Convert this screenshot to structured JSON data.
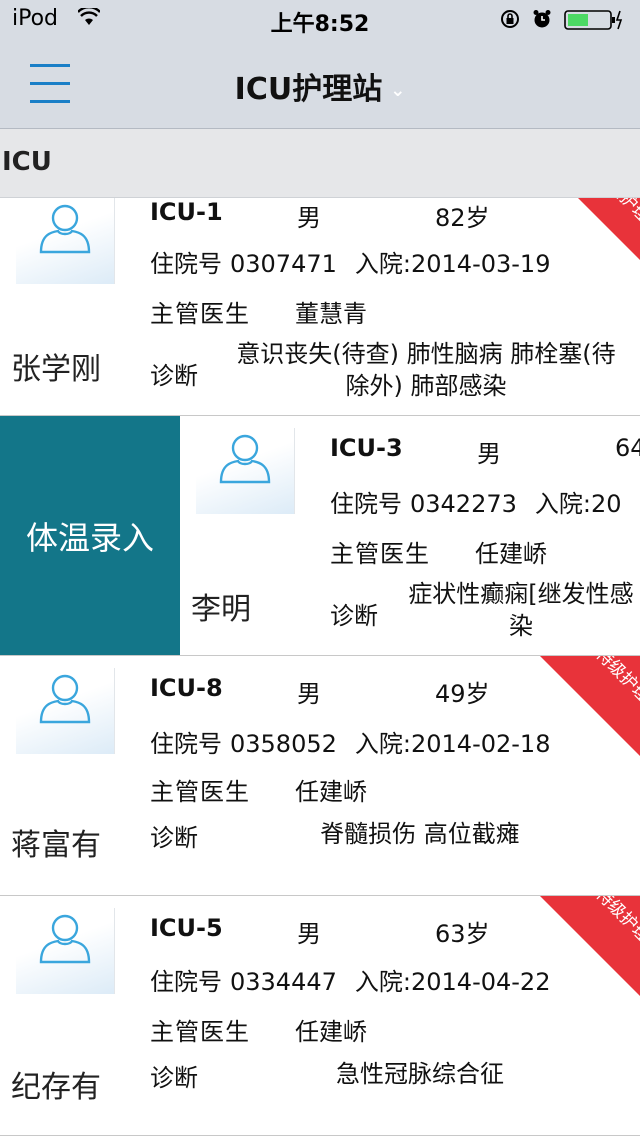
{
  "status_bar": {
    "carrier": "iPod",
    "time": "上午8:52"
  },
  "nav": {
    "title": "ICU护理站",
    "title_chevron": "⌄",
    "menu_icon": "hamburger-menu-icon"
  },
  "section": {
    "title": "ICU"
  },
  "swipe_action": {
    "label": "体温录入"
  },
  "patients": [
    {
      "bed": "ICU-1",
      "gender": "男",
      "age": "82岁",
      "admission_label": "住院号",
      "admission_no": "0307471",
      "admit_label": "入院:",
      "admit_date": "2014-03-19 ",
      "doctor_label": "主管医生",
      "doctor": "董慧青",
      "diagnosis_label": "诊断",
      "diagnosis": "意识丧失(待查) 肺性脑病 肺栓塞(待除外) 肺部感染",
      "name": "张学刚",
      "badge": "特级护理"
    },
    {
      "bed": "ICU-3",
      "gender": "男",
      "age": "64",
      "admission_label": "住院号",
      "admission_no": "0342273",
      "admit_label": "入院:",
      "admit_date": "20",
      "doctor_label": "主管医生",
      "doctor": "任建峤",
      "diagnosis_label": "诊断",
      "diagnosis": "症状性癫痫[继发性感染",
      "name": "李明",
      "badge": ""
    },
    {
      "bed": "ICU-8",
      "gender": "男",
      "age": "49岁",
      "admission_label": "住院号",
      "admission_no": "0358052",
      "admit_label": "入院:",
      "admit_date": "2014-02-18 ",
      "doctor_label": "主管医生",
      "doctor": "任建峤",
      "diagnosis_label": "诊断",
      "diagnosis": "脊髓损伤 高位截瘫",
      "name": "蒋富有",
      "badge": "特级护理"
    },
    {
      "bed": "ICU-5",
      "gender": "男",
      "age": "63岁",
      "admission_label": "住院号",
      "admission_no": "0334447",
      "admit_label": "入院:",
      "admit_date": "2014-04-22",
      "doctor_label": "主管医生",
      "doctor": "任建峤",
      "diagnosis_label": "诊断",
      "diagnosis": "急性冠脉综合征",
      "name": "纪存有",
      "badge": "特级护理"
    }
  ],
  "colors": {
    "bar_bg": "#d7dce3",
    "accent": "#1a7fc7",
    "swipe_bg": "#137689",
    "badge_red": "#e8333a"
  }
}
